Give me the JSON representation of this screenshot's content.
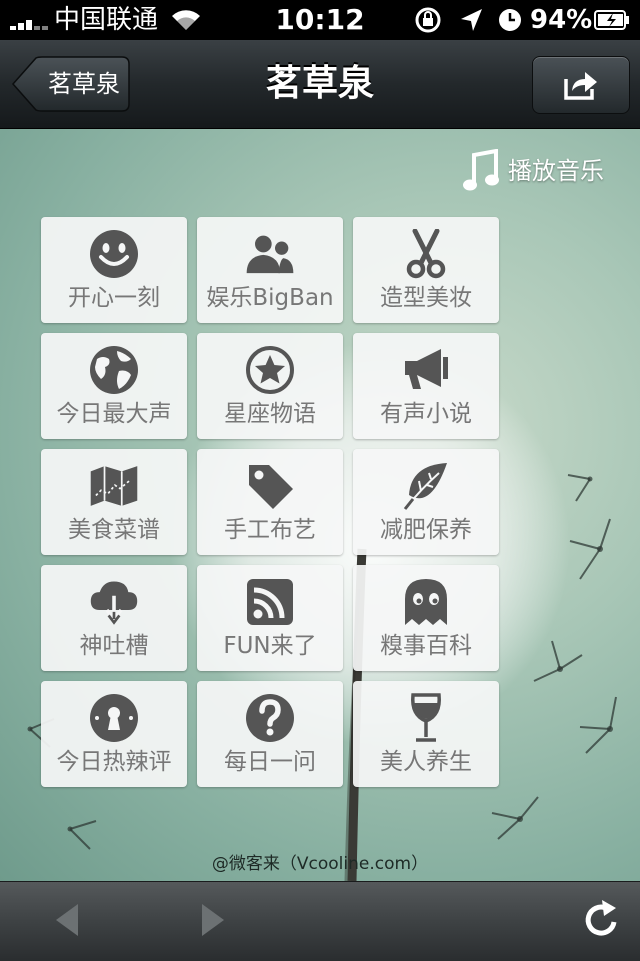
{
  "status_bar": {
    "carrier": "中国联通",
    "time": "10:12",
    "battery": "94%",
    "icons": [
      "signal-icon",
      "wifi-icon",
      "rotation-lock-icon",
      "location-icon",
      "alarm-icon",
      "battery-icon"
    ]
  },
  "nav": {
    "back_label": "茗草泉",
    "title": "茗草泉",
    "share_icon": "share-icon"
  },
  "music": {
    "label": "播放音乐",
    "icon": "music-note-icon"
  },
  "grid": [
    {
      "label": "开心一刻",
      "icon": "smiley-icon"
    },
    {
      "label": "娱乐BigBan",
      "icon": "people-icon"
    },
    {
      "label": "造型美妆",
      "icon": "scissors-icon"
    },
    {
      "label": "今日最大声",
      "icon": "globe-icon"
    },
    {
      "label": "星座物语",
      "icon": "star-icon"
    },
    {
      "label": "有声小说",
      "icon": "megaphone-icon"
    },
    {
      "label": "美食菜谱",
      "icon": "map-icon"
    },
    {
      "label": "手工布艺",
      "icon": "tag-icon"
    },
    {
      "label": "减肥保养",
      "icon": "leaf-icon"
    },
    {
      "label": "神吐槽",
      "icon": "cloud-download-icon"
    },
    {
      "label": "FUN来了",
      "icon": "rss-icon"
    },
    {
      "label": "糗事百科",
      "icon": "ghost-icon"
    },
    {
      "label": "今日热辣评",
      "icon": "keyhole-icon"
    },
    {
      "label": "每日一问",
      "icon": "question-icon"
    },
    {
      "label": "美人养生",
      "icon": "wine-glass-icon"
    }
  ],
  "footer": {
    "credit": "@微客来（Vcooline.com）"
  },
  "toolbar": {
    "icons": [
      "back-arrow-icon",
      "forward-arrow-icon",
      "refresh-icon"
    ]
  },
  "colors": {
    "tile_icon": "#555555",
    "tile_label": "#777777",
    "nav_bg": "#23282b"
  }
}
